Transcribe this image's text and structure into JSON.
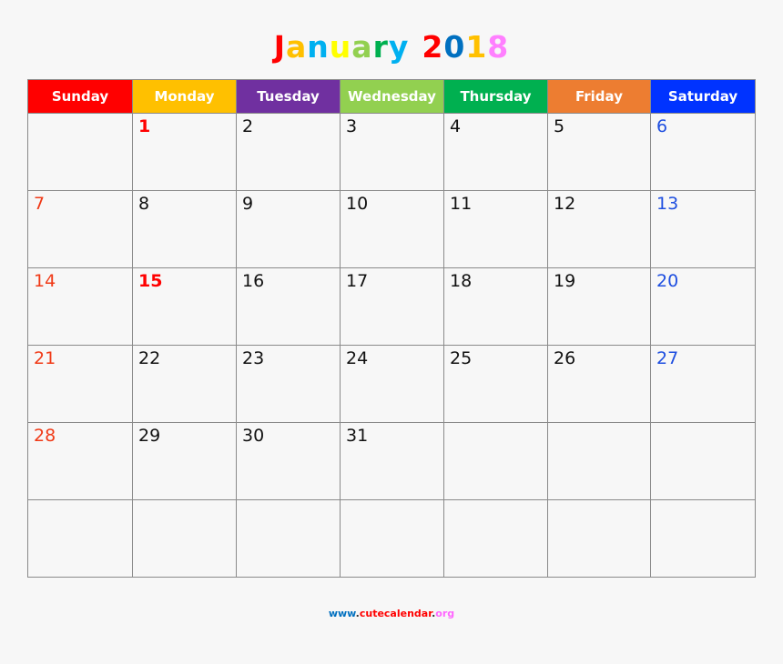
{
  "title": {
    "letters": [
      {
        "ch": "J",
        "color": "#ff0000"
      },
      {
        "ch": "a",
        "color": "#ffc000"
      },
      {
        "ch": "n",
        "color": "#00b0f0"
      },
      {
        "ch": "u",
        "color": "#ffff00"
      },
      {
        "ch": "a",
        "color": "#92d050"
      },
      {
        "ch": "r",
        "color": "#00b050"
      },
      {
        "ch": "y",
        "color": "#00b0f0"
      },
      {
        "ch": " ",
        "color": "#000000"
      },
      {
        "ch": "2",
        "color": "#ff0000"
      },
      {
        "ch": "0",
        "color": "#0070c0"
      },
      {
        "ch": "1",
        "color": "#ffc000"
      },
      {
        "ch": "8",
        "color": "#ff80ff"
      }
    ],
    "text": "January 2018"
  },
  "weekdays": [
    {
      "label": "Sunday",
      "color": "#ff0000"
    },
    {
      "label": "Monday",
      "color": "#ffc000"
    },
    {
      "label": "Tuesday",
      "color": "#7030a0"
    },
    {
      "label": "Wednesday",
      "color": "#92d050"
    },
    {
      "label": "Thursday",
      "color": "#00b050"
    },
    {
      "label": "Friday",
      "color": "#ed7d31"
    },
    {
      "label": "Saturday",
      "color": "#0033ff"
    }
  ],
  "weeks": [
    [
      "",
      "1",
      "2",
      "3",
      "4",
      "5",
      "6"
    ],
    [
      "7",
      "8",
      "9",
      "10",
      "11",
      "12",
      "13"
    ],
    [
      "14",
      "15",
      "16",
      "17",
      "18",
      "19",
      "20"
    ],
    [
      "21",
      "22",
      "23",
      "24",
      "25",
      "26",
      "27"
    ],
    [
      "28",
      "29",
      "30",
      "31",
      "",
      "",
      ""
    ],
    [
      "",
      "",
      "",
      "",
      "",
      "",
      ""
    ]
  ],
  "holidays": [
    "1",
    "15"
  ],
  "footer": [
    {
      "text": "www",
      "color": "#0070c0"
    },
    {
      "text": ".",
      "color": "#333333"
    },
    {
      "text": "cutecalendar",
      "color": "#ff0000"
    },
    {
      "text": ".",
      "color": "#333333"
    },
    {
      "text": "org",
      "color": "#ff66ff"
    }
  ]
}
